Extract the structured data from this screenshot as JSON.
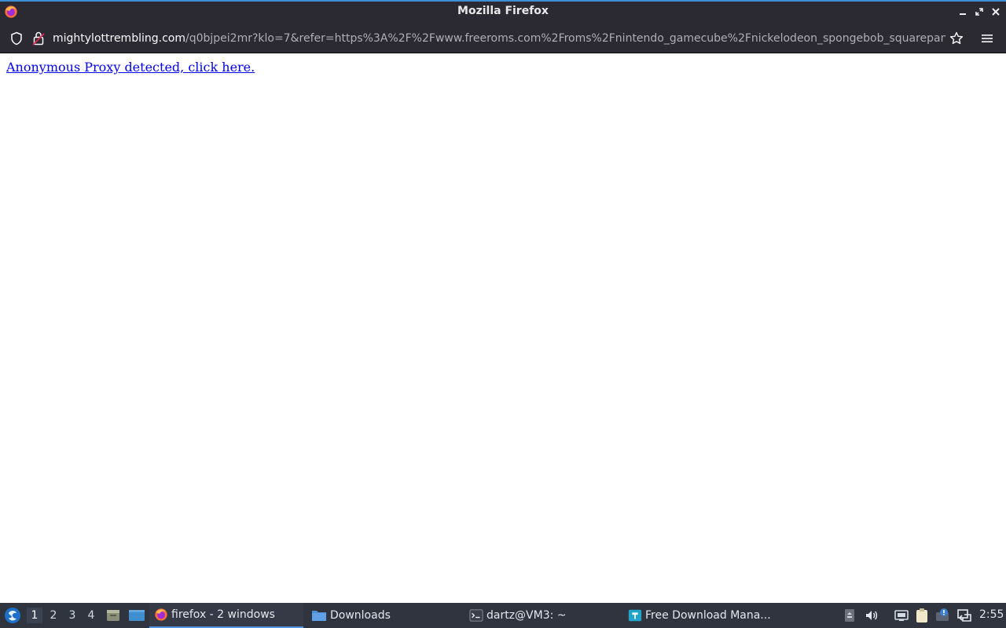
{
  "window": {
    "title": "Mozilla Firefox"
  },
  "navbar": {
    "url_host": "mightylottrembling.com",
    "url_path": "/q0bjpei2mr?klo=7&refer=https%3A%2F%2Fwww.freeroms.com%2Froms%2Fnintendo_gamecube%2Fnickelodeon_spongebob_squarepants"
  },
  "page": {
    "link_text": "Anonymous Proxy detected, click here."
  },
  "taskbar": {
    "workspaces": [
      "1",
      "2",
      "3",
      "4"
    ],
    "active_workspace": "1",
    "tasks": [
      {
        "label": "firefox - 2 windows",
        "icon": "firefox-icon"
      },
      {
        "label": "Downloads",
        "icon": "folder-icon"
      },
      {
        "label": "dartz@VM3: ~",
        "icon": "terminal-icon"
      },
      {
        "label": "Free Download Mana...",
        "icon": "download-manager-icon"
      }
    ],
    "clock": "2:55"
  },
  "colors": {
    "titlebar_bg": "#2b2a33",
    "taskbar_bg": "#2f343f",
    "link": "#0000ee",
    "accent": "#5294e2"
  }
}
